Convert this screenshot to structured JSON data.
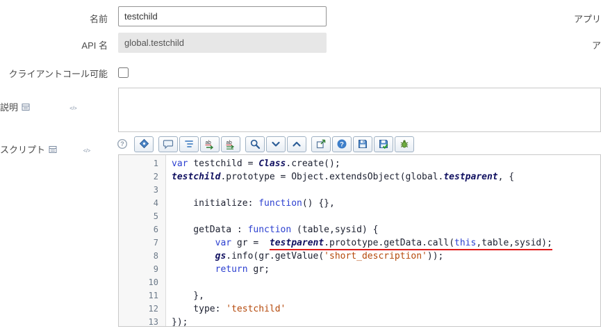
{
  "form": {
    "rows": [
      {
        "label": "名前",
        "type": "input",
        "value": "testchild"
      },
      {
        "label": "API 名",
        "type": "readonly",
        "value": "global.testchild"
      },
      {
        "label": "クライアントコール可能",
        "type": "checkbox",
        "checked": false
      },
      {
        "label": "説明",
        "type": "textarea",
        "value": "",
        "icons": [
          "translate-field-icon",
          "code-tag-icon"
        ]
      },
      {
        "label": "スクリプト",
        "type": "script",
        "icons": [
          "translate-field-icon",
          "code-tag-icon"
        ]
      }
    ],
    "right_column": {
      "labels": [
        "アプリ",
        "ア"
      ]
    }
  },
  "script_editor": {
    "toolbar": {
      "groups": [
        {
          "plain": true,
          "buttons": [
            {
              "name": "field-help",
              "icon": "help-circle"
            }
          ]
        },
        {
          "buttons": [
            {
              "name": "toggle-syntax-editor",
              "icon": "syntax-tag"
            }
          ]
        },
        {
          "buttons": [
            {
              "name": "toggle-comment",
              "icon": "comment-bubble"
            },
            {
              "name": "format-code",
              "icon": "format-lines"
            },
            {
              "name": "replace",
              "icon": "replace"
            },
            {
              "name": "replace-all",
              "icon": "replace-all"
            }
          ]
        },
        {
          "buttons": [
            {
              "name": "search",
              "icon": "magnifier"
            },
            {
              "name": "find-next",
              "icon": "chevron-down"
            },
            {
              "name": "find-previous",
              "icon": "chevron-up"
            }
          ]
        },
        {
          "buttons": [
            {
              "name": "open-in-new-window",
              "icon": "popout"
            },
            {
              "name": "help",
              "icon": "help-filled"
            },
            {
              "name": "save",
              "icon": "floppy"
            },
            {
              "name": "check-syntax",
              "icon": "floppy-check"
            },
            {
              "name": "script-debugger",
              "icon": "bug"
            }
          ]
        }
      ]
    },
    "colors": {
      "keyword": "#2b3fd0",
      "string": "#b5490b",
      "classref": "#101060",
      "default": "#1c2030",
      "error_underline": "#e01818"
    },
    "lines": [
      {
        "n": 1,
        "tokens": [
          {
            "t": "var ",
            "c": "k"
          },
          {
            "t": "testchild = ",
            "c": "p"
          },
          {
            "t": "Class",
            "c": "v"
          },
          {
            "t": ".create();",
            "c": "p"
          }
        ]
      },
      {
        "n": 2,
        "tokens": [
          {
            "t": "testchild",
            "c": "v"
          },
          {
            "t": ".prototype = Object.extendsObject(global.",
            "c": "p"
          },
          {
            "t": "testparent",
            "c": "v"
          },
          {
            "t": ", {",
            "c": "p"
          }
        ]
      },
      {
        "n": 3,
        "tokens": []
      },
      {
        "n": 4,
        "tokens": [
          {
            "t": "    initialize: ",
            "c": "p"
          },
          {
            "t": "function",
            "c": "k"
          },
          {
            "t": "() {},",
            "c": "p"
          }
        ]
      },
      {
        "n": 5,
        "tokens": []
      },
      {
        "n": 6,
        "tokens": [
          {
            "t": "    getData : ",
            "c": "p"
          },
          {
            "t": "function",
            "c": "k"
          },
          {
            "t": " (table,sysid) {",
            "c": "p"
          }
        ]
      },
      {
        "n": 7,
        "tokens": [
          {
            "t": "        ",
            "c": "p"
          },
          {
            "t": "var",
            "c": "k"
          },
          {
            "t": " gr =  ",
            "c": "p"
          },
          {
            "t": "testparent",
            "c": "v",
            "u": true
          },
          {
            "t": ".prototype.getData.call(",
            "c": "p",
            "u": true
          },
          {
            "t": "this",
            "c": "k",
            "u": true
          },
          {
            "t": ",table,sysid);",
            "c": "p",
            "u": true
          }
        ]
      },
      {
        "n": 8,
        "tokens": [
          {
            "t": "        ",
            "c": "p"
          },
          {
            "t": "gs",
            "c": "v"
          },
          {
            "t": ".info(gr.getValue(",
            "c": "p"
          },
          {
            "t": "'short_description'",
            "c": "s"
          },
          {
            "t": "));",
            "c": "p"
          }
        ]
      },
      {
        "n": 9,
        "tokens": [
          {
            "t": "        ",
            "c": "p"
          },
          {
            "t": "return",
            "c": "k"
          },
          {
            "t": " gr;",
            "c": "p"
          }
        ]
      },
      {
        "n": 10,
        "tokens": []
      },
      {
        "n": 11,
        "tokens": [
          {
            "t": "    },",
            "c": "p"
          }
        ]
      },
      {
        "n": 12,
        "tokens": [
          {
            "t": "    type: ",
            "c": "p"
          },
          {
            "t": "'testchild'",
            "c": "s"
          }
        ]
      },
      {
        "n": 13,
        "tokens": [
          {
            "t": "});",
            "c": "p"
          }
        ]
      }
    ]
  }
}
